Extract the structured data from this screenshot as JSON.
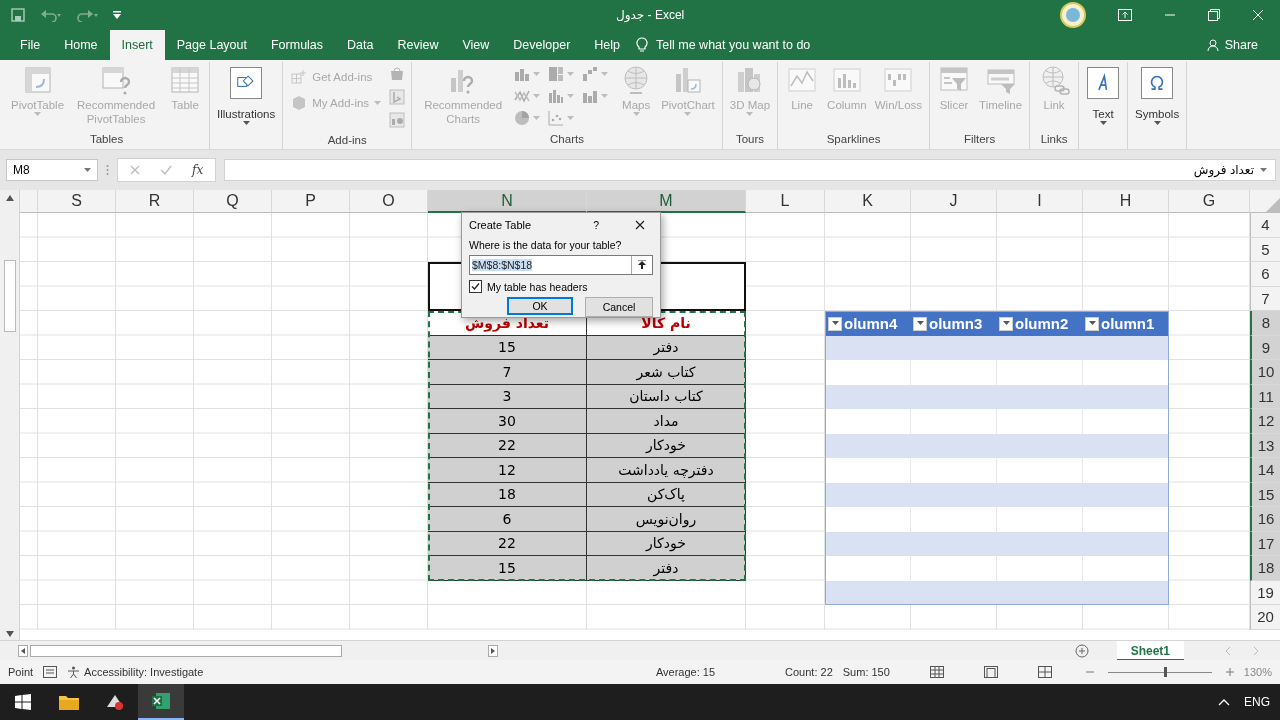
{
  "window": {
    "title": "جدول - Excel"
  },
  "tabs": [
    {
      "label": "File",
      "selected": false
    },
    {
      "label": "Home",
      "selected": false
    },
    {
      "label": "Insert",
      "selected": true
    },
    {
      "label": "Page Layout",
      "selected": false
    },
    {
      "label": "Formulas",
      "selected": false
    },
    {
      "label": "Data",
      "selected": false
    },
    {
      "label": "Review",
      "selected": false
    },
    {
      "label": "View",
      "selected": false
    },
    {
      "label": "Developer",
      "selected": false
    },
    {
      "label": "Help",
      "selected": false
    }
  ],
  "tell_me": "Tell me what you want to do",
  "share": "Share",
  "ribbon_groups": [
    {
      "label": "Tables",
      "buttons": [
        {
          "kind": "large",
          "label": "PivotTable",
          "disabled": true,
          "dropdown": true
        },
        {
          "kind": "large",
          "label": "Recommended PivotTables",
          "disabled": true,
          "dropdown": false
        },
        {
          "kind": "large",
          "label": "Table",
          "disabled": true,
          "dropdown": false
        }
      ]
    },
    {
      "buttons": [
        {
          "kind": "boxed",
          "label": "Illustrations",
          "disabled": false,
          "dropdown": true
        }
      ]
    },
    {
      "label": "Add-ins",
      "buttons": [
        {
          "kind": "small",
          "label": "Get Add-ins",
          "disabled": true,
          "dropdown": false
        },
        {
          "kind": "small",
          "label": "My Add-ins",
          "disabled": true,
          "dropdown": true
        },
        {
          "kind": "icon-column",
          "disabled": true
        }
      ]
    },
    {
      "label": "Charts",
      "buttons": [
        {
          "kind": "large",
          "label": "Recommended Charts",
          "disabled": true,
          "dropdown": false
        },
        {
          "kind": "icon-grid",
          "disabled": true
        },
        {
          "kind": "large",
          "label": "Maps",
          "disabled": true,
          "dropdown": true
        },
        {
          "kind": "large",
          "label": "PivotChart",
          "disabled": true,
          "dropdown": true
        }
      ]
    },
    {
      "label": "Tours",
      "buttons": [
        {
          "kind": "large",
          "label": "3D Map",
          "disabled": true,
          "dropdown": true
        }
      ]
    },
    {
      "label": "Sparklines",
      "buttons": [
        {
          "kind": "large",
          "label": "Line",
          "disabled": true,
          "dropdown": false
        },
        {
          "kind": "large",
          "label": "Column",
          "disabled": true,
          "dropdown": false
        },
        {
          "kind": "large",
          "label": "Win/Loss",
          "disabled": true,
          "dropdown": false
        }
      ]
    },
    {
      "label": "Filters",
      "buttons": [
        {
          "kind": "large",
          "label": "Slicer",
          "disabled": true,
          "dropdown": false
        },
        {
          "kind": "large",
          "label": "Timeline",
          "disabled": true,
          "dropdown": false
        }
      ]
    },
    {
      "label": "Links",
      "buttons": [
        {
          "kind": "large",
          "label": "Link",
          "disabled": true,
          "dropdown": false
        }
      ]
    },
    {
      "buttons": [
        {
          "kind": "boxed",
          "label": "Text",
          "disabled": false,
          "dropdown": true
        }
      ]
    },
    {
      "buttons": [
        {
          "kind": "boxed",
          "label": "Symbols",
          "disabled": false,
          "dropdown": true
        }
      ]
    }
  ],
  "formula_bar": {
    "name_box": "M8",
    "function_label": "fx",
    "content": "تعداد فروش"
  },
  "sheet": {
    "columns": [
      {
        "label": "S",
        "selected": false
      },
      {
        "label": "R",
        "selected": false
      },
      {
        "label": "Q",
        "selected": false
      },
      {
        "label": "P",
        "selected": false
      },
      {
        "label": "O",
        "selected": false
      },
      {
        "label": "N",
        "selected": true
      },
      {
        "label": "M",
        "selected": true
      },
      {
        "label": "L",
        "selected": false
      },
      {
        "label": "K",
        "selected": false
      },
      {
        "label": "J",
        "selected": false
      },
      {
        "label": "I",
        "selected": false
      },
      {
        "label": "H",
        "selected": false
      },
      {
        "label": "G",
        "selected": false
      }
    ],
    "rows": [
      {
        "label": "4",
        "selected": false
      },
      {
        "label": "5",
        "selected": false
      },
      {
        "label": "6",
        "selected": false
      },
      {
        "label": "7",
        "selected": false
      },
      {
        "label": "8",
        "selected": true
      },
      {
        "label": "9",
        "selected": true
      },
      {
        "label": "10",
        "selected": true
      },
      {
        "label": "11",
        "selected": true
      },
      {
        "label": "12",
        "selected": true
      },
      {
        "label": "13",
        "selected": true
      },
      {
        "label": "14",
        "selected": true
      },
      {
        "label": "15",
        "selected": true
      },
      {
        "label": "16",
        "selected": true
      },
      {
        "label": "17",
        "selected": true
      },
      {
        "label": "18",
        "selected": true
      },
      {
        "label": "19",
        "selected": false
      },
      {
        "label": "20",
        "selected": false
      }
    ],
    "sales_table": {
      "columns": [
        {
          "header": "نام کالا",
          "values": [
            "دفتر",
            "کتاب شعر",
            "کتاب داستان",
            "مداد",
            "خودکار",
            "دفترچه یادداشت",
            "پاک‌کن",
            "روان‌نویس",
            "خودکار",
            "دفتر"
          ]
        },
        {
          "header": "تعداد فروش",
          "values": [
            "15",
            "7",
            "3",
            "30",
            "22",
            "12",
            "18",
            "6",
            "22",
            "15"
          ]
        }
      ]
    },
    "new_table": {
      "headers": [
        "olumn4",
        "olumn3",
        "olumn2",
        "olumn1"
      ]
    }
  },
  "dialog": {
    "title": "Create Table",
    "help": "?",
    "prompt": "Where is the data for your table?",
    "range": "$M$8:$N$18",
    "headers_checkbox": {
      "label": "My table has headers",
      "checked": true
    },
    "buttons": [
      {
        "label": "OK",
        "default": true
      },
      {
        "label": "Cancel",
        "default": false
      }
    ]
  },
  "sheet_tabs": [
    {
      "label": "Sheet1",
      "selected": true
    }
  ],
  "status_bar": {
    "mode": "Point",
    "accessibility": "Accessibility: Investigate",
    "average": "Average: 15",
    "count": "Count: 22",
    "sum": "Sum: 150",
    "zoom_slider": {
      "level": 0.55
    },
    "zoom": "130%"
  },
  "taskbar": {
    "language": "ENG"
  }
}
